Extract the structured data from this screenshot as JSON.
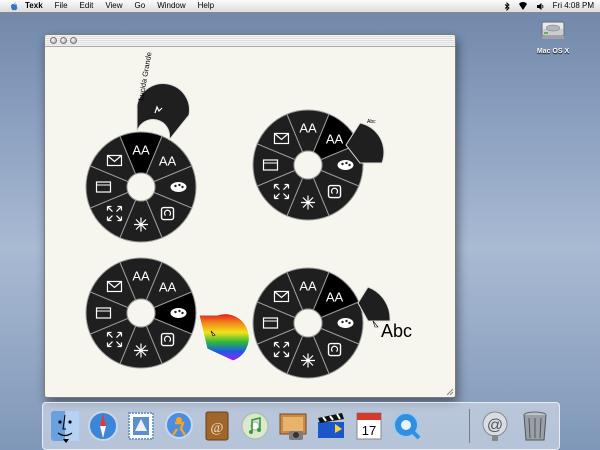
{
  "menubar": {
    "app_name": "Texk",
    "menus": [
      "File",
      "Edit",
      "View",
      "Go",
      "Window",
      "Help"
    ],
    "clock": "Fri 4:08 PM"
  },
  "desktop": {
    "disk_label": "Mac OS X"
  },
  "canvas": {
    "font_label": "Lucida Grande",
    "small_sample": "Abc",
    "large_sample": "Abc",
    "font_glyph": "AA"
  },
  "dock": {
    "items": [
      "finder",
      "safari",
      "mail",
      "ichat",
      "address-book",
      "itunes",
      "iphoto",
      "imovie",
      "ical",
      "quicktime",
      "system-preferences",
      "trash"
    ],
    "ical_date": "17"
  },
  "colors": {
    "pie_fill": "#1f1f1f",
    "pie_stroke": "#9a9a9a",
    "window_bg": "#f7f6ee"
  }
}
